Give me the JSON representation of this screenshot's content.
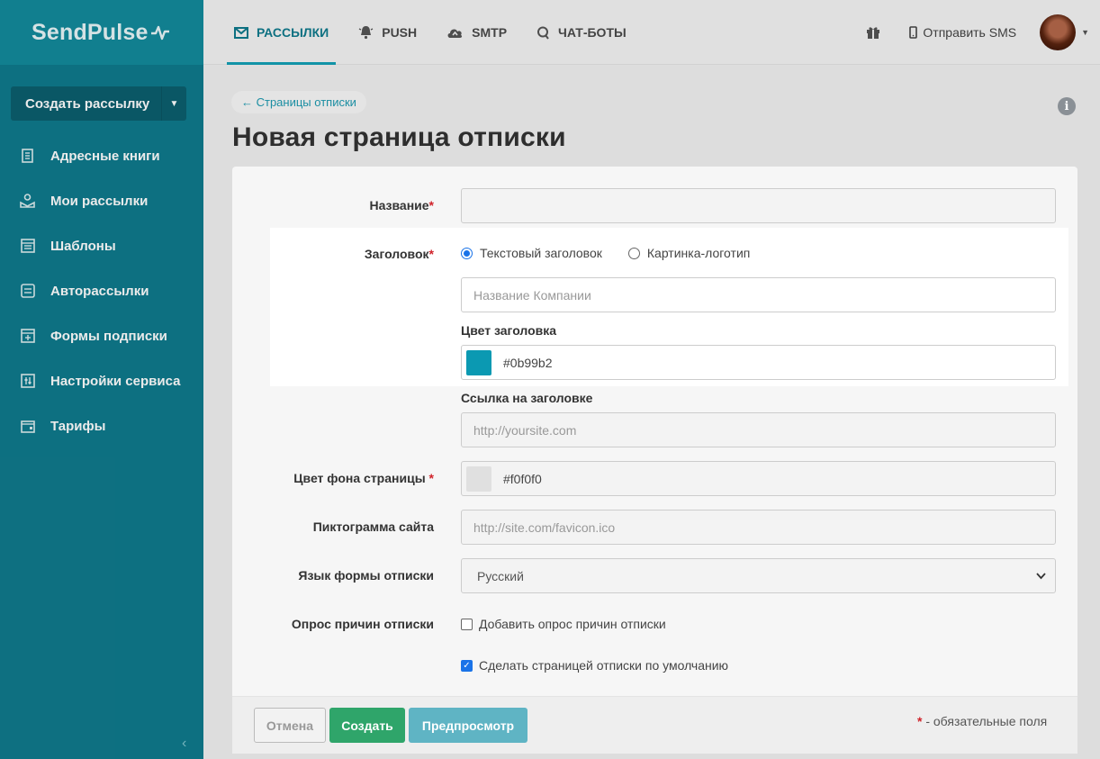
{
  "brand": {
    "name": "SendPulse"
  },
  "sidebar": {
    "create_button": "Создать рассылку",
    "items": [
      {
        "label": "Адресные книги",
        "icon": "address-book-icon"
      },
      {
        "label": "Мои рассылки",
        "icon": "mailings-icon"
      },
      {
        "label": "Шаблоны",
        "icon": "templates-icon"
      },
      {
        "label": "Авторассылки",
        "icon": "automation-icon"
      },
      {
        "label": "Формы подписки",
        "icon": "forms-icon"
      },
      {
        "label": "Настройки сервиса",
        "icon": "settings-icon"
      },
      {
        "label": "Тарифы",
        "icon": "wallet-icon"
      }
    ]
  },
  "topnav": {
    "tabs": [
      {
        "label": "РАССЫЛКИ",
        "icon": "envelope-icon",
        "active": true
      },
      {
        "label": "PUSH",
        "icon": "bell-icon",
        "active": false
      },
      {
        "label": "SMTP",
        "icon": "cloud-upload-icon",
        "active": false
      },
      {
        "label": "ЧАТ-БОТЫ",
        "icon": "chat-icon",
        "active": false
      }
    ],
    "sms_label": "Отправить SMS"
  },
  "breadcrumb": "← Страницы отписки",
  "page_title": "Новая страница отписки",
  "form": {
    "name_label": "Название",
    "header_label": "Заголовок",
    "radio_text": "Текстовый заголовок",
    "radio_logo": "Картинка-логотип",
    "company_placeholder": "Название Компании",
    "header_color_label": "Цвет заголовка",
    "header_color_value": "#0b99b2",
    "header_link_label": "Ссылка на заголовке",
    "header_link_placeholder": "http://yoursite.com",
    "bg_color_label": "Цвет фона страницы",
    "bg_color_value": "#f0f0f0",
    "favicon_label": "Пиктограмма сайта",
    "favicon_placeholder": "http://site.com/favicon.ico",
    "language_label": "Язык формы отписки",
    "language_value": "Русский",
    "survey_label": "Опрос причин отписки",
    "survey_checkbox": "Добавить опрос причин отписки",
    "default_checkbox": "Сделать страницей отписки по умолчанию",
    "required_mark": "*"
  },
  "buttons": {
    "cancel": "Отмена",
    "create": "Создать",
    "preview": "Предпросмотр"
  },
  "required_note": "- обязательные поля",
  "colors": {
    "accent": "#0f7a8c",
    "header_swatch": "#0b99b2",
    "bg_swatch": "#e0e0e0",
    "create_button": "#2fa56a",
    "preview_button": "#5fb4c4"
  }
}
